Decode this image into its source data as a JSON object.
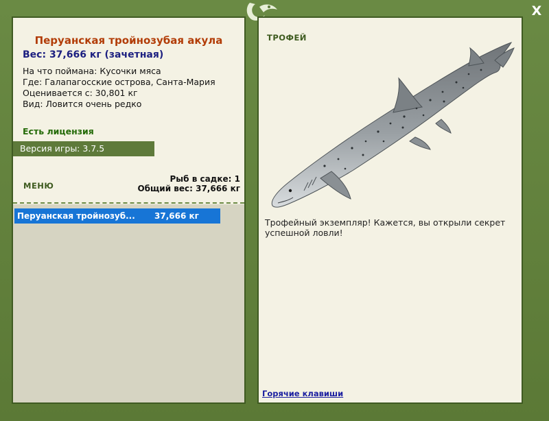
{
  "fish": {
    "name": "Перуанская тройнозубая акула",
    "weight": "Вес: 37,666 кг (зачетная)",
    "bait": "На что поймана: Кусочки мяса",
    "location": "Где: Галапагосские острова, Санта-Мария",
    "rated_from": "Оценивается с: 30,801 кг",
    "rarity": "Вид: Ловится очень редко"
  },
  "license": "Есть лицензия",
  "version": "Версия игры: 3.7.5",
  "menu": {
    "label": "МЕНЮ"
  },
  "cage": {
    "count": "Рыб в садке: 1",
    "total_weight": "Общий вес: 37,666 кг"
  },
  "catch_list": [
    {
      "name": "Перуанская тройнозуб...",
      "weight": "37,666 кг"
    }
  ],
  "trophy": {
    "label": "ТРОФЕЙ",
    "text": "Трофейный экземпляр! Кажется, вы открыли секрет успешной ловли!"
  },
  "hotkeys": "Горячие клавиши",
  "close": "X",
  "icons": {
    "logo": "fish-hook-logo-icon",
    "close": "close-icon"
  },
  "colors": {
    "frame": "#5c7a3a",
    "panel": "#f4f2e4",
    "fish_name": "#b23d08",
    "weight": "#1c1f80",
    "license": "#246b08",
    "selected_row": "#1775d6",
    "link": "#1a1ea0"
  }
}
